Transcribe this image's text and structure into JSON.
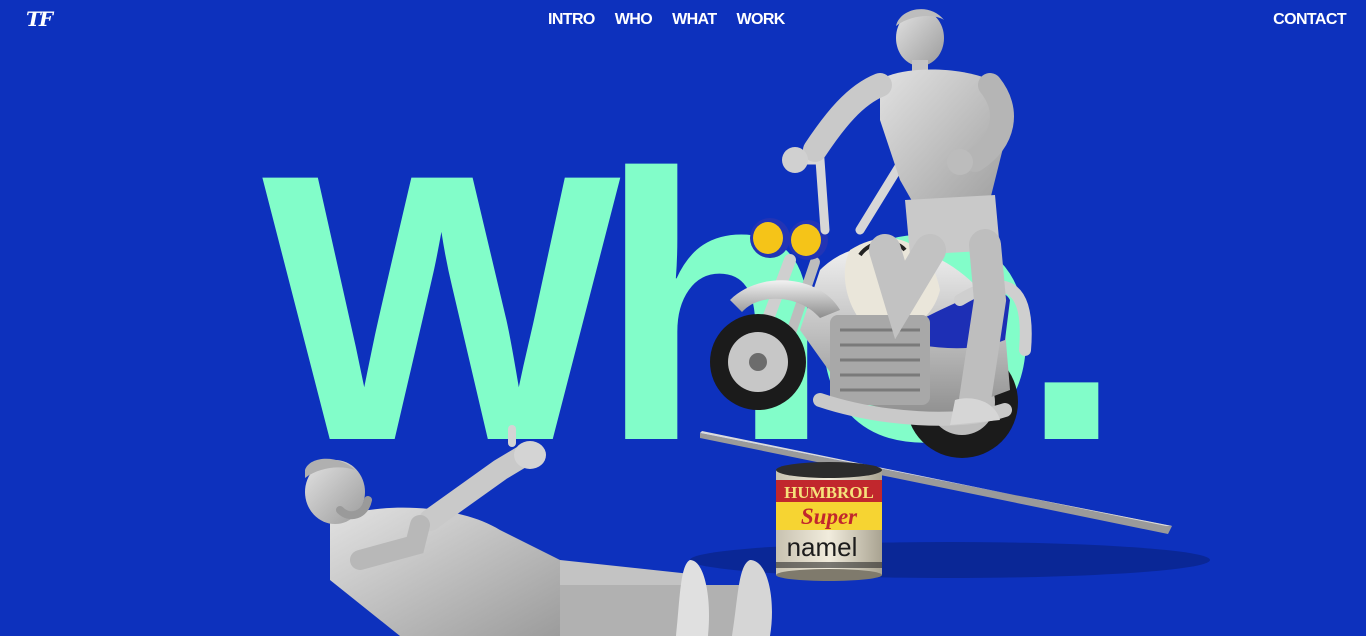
{
  "logo": {
    "text": "TF"
  },
  "nav": {
    "items": [
      {
        "label": "INTRO"
      },
      {
        "label": "WHO"
      },
      {
        "label": "WHAT"
      },
      {
        "label": "WORK"
      }
    ],
    "contact_label": "CONTACT"
  },
  "hero": {
    "word": "Who."
  },
  "paint_tin": {
    "brand": "HUMBROL",
    "line1": "Super",
    "line2": "namel"
  },
  "colors": {
    "background": "#0d31bd",
    "accent": "#82fdc9",
    "nav_text": "#ffffff"
  }
}
